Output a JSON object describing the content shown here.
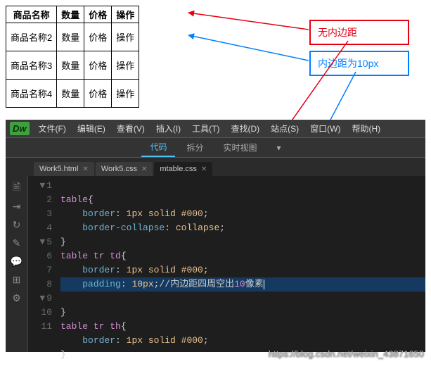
{
  "table": {
    "headers": [
      "商品名称",
      "数量",
      "价格",
      "操作"
    ],
    "rows": [
      [
        "商品名称2",
        "数量",
        "价格",
        "操作"
      ],
      [
        "商品名称3",
        "数量",
        "价格",
        "操作"
      ],
      [
        "商品名称4",
        "数量",
        "价格",
        "操作"
      ]
    ]
  },
  "annotations": {
    "no_padding": "无内边距",
    "padding_10": "内边距为10px"
  },
  "editor": {
    "logo": "Dw",
    "menu": [
      "文件(F)",
      "编辑(E)",
      "查看(V)",
      "插入(I)",
      "工具(T)",
      "查找(D)",
      "站点(S)",
      "窗口(W)",
      "帮助(H)"
    ],
    "views": {
      "code": "代码",
      "split": "拆分",
      "live": "实时视图"
    },
    "tabs": [
      {
        "name": "Work5.html"
      },
      {
        "name": "Work5.css"
      },
      {
        "name": "mtable.css",
        "active": true
      }
    ],
    "code_lines": {
      "1": {
        "sel": "table",
        "b": "{"
      },
      "2": {
        "prop": "border",
        "val": "1px solid #000",
        "sc": ";"
      },
      "3": {
        "prop": "border-collapse",
        "val": "collapse",
        "sc": ";"
      },
      "4": {
        "b": "}"
      },
      "5": {
        "sel": "table tr td",
        "b": "{"
      },
      "6": {
        "prop": "border",
        "val": "1px solid #000",
        "sc": ";"
      },
      "7": {
        "prop": "padding",
        "val": "10px",
        "sc": ";",
        "comment_a": "//内边距四周空出",
        "comment_n": "10",
        "comment_b": "像素"
      },
      "8": {
        "b": "}"
      },
      "9": {
        "sel": "table tr th",
        "b": "{"
      },
      "10": {
        "prop": "border",
        "val": "1px solid #000",
        "sc": ";"
      },
      "11": {
        "b": "}"
      }
    }
  },
  "watermark": "https://blog.csdn.net/weixin_43871650"
}
